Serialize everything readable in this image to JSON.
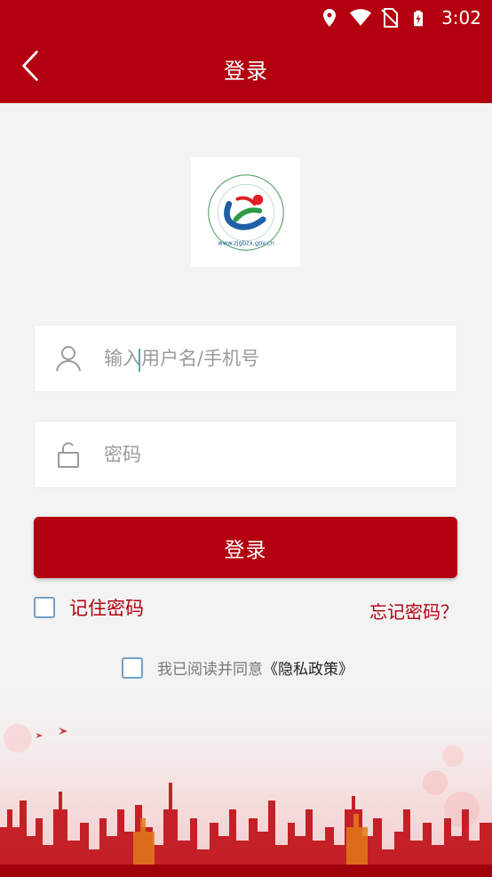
{
  "status_bar": {
    "time": "3:02",
    "icons": [
      "location-icon",
      "wifi-icon",
      "no-sim-icon",
      "battery-charging-icon"
    ]
  },
  "header": {
    "title": "登录",
    "back_icon": "chevron-left-icon",
    "bg_color": "#b3010f"
  },
  "logo": {
    "name": "org-logo",
    "text": "www.zjgbzx.gov.cn"
  },
  "form": {
    "username": {
      "placeholder": "输入用户名/手机号",
      "value": "",
      "icon": "user-icon"
    },
    "password": {
      "placeholder": "密码",
      "value": "",
      "icon": "lock-icon"
    },
    "login_label": "登录",
    "remember_label": "记住密码",
    "forgot_label": "忘记密码？",
    "agree_prefix": "我已阅读并同意",
    "policy_link": "《隐私政策》"
  },
  "colors": {
    "accent": "#b3010f",
    "checkbox_border": "#6fa0c9",
    "cursor": "#3cb3a6"
  }
}
